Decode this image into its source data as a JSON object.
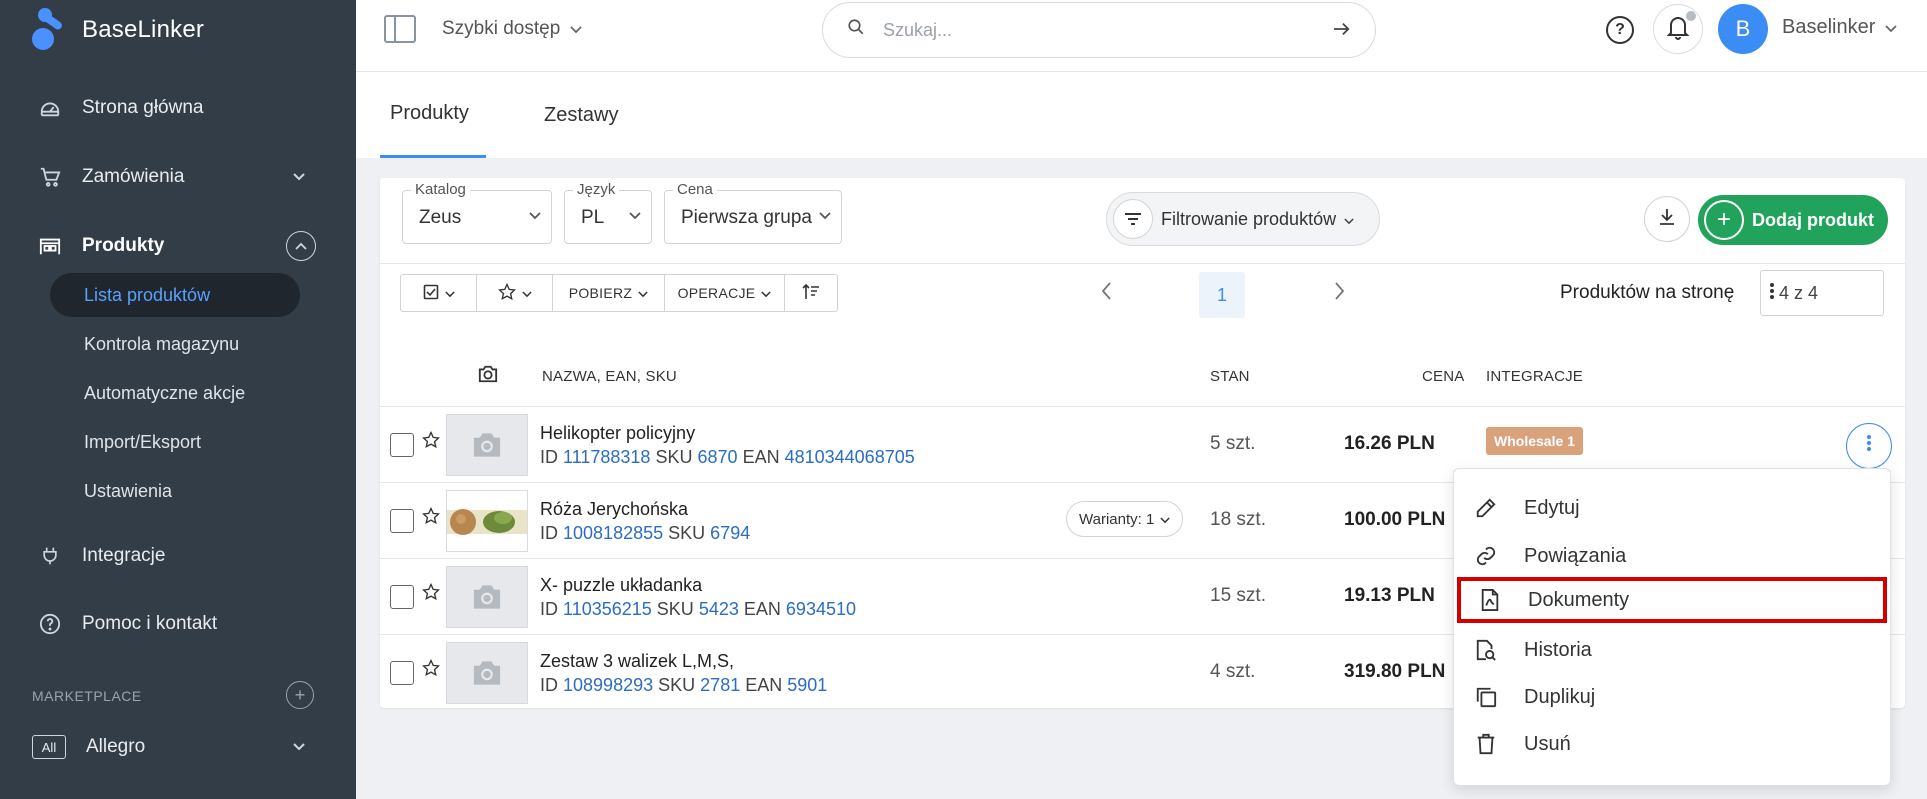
{
  "brand": {
    "name": "BaseLinker",
    "accent": "#3b8cf5",
    "sidebar_bg": "#333d47"
  },
  "sidebar": {
    "items": [
      {
        "label": "Strona główna",
        "icon": "dashboard-icon"
      },
      {
        "label": "Zamówienia",
        "icon": "cart-icon"
      },
      {
        "label": "Produkty",
        "icon": "warehouse-icon"
      },
      {
        "label": "Integracje",
        "icon": "plug-icon"
      },
      {
        "label": "Pomoc i kontakt",
        "icon": "help-circle-icon"
      }
    ],
    "sub_items": [
      {
        "label": "Lista produktów"
      },
      {
        "label": "Kontrola magazynu"
      },
      {
        "label": "Automatyczne akcje"
      },
      {
        "label": "Import/Eksport"
      },
      {
        "label": "Ustawienia"
      }
    ],
    "marketplace_label": "MARKETPLACE",
    "allegro": {
      "badge": "All",
      "label": "Allegro"
    }
  },
  "topbar": {
    "quick_access": "Szybki dostęp",
    "search_placeholder": "Szukaj...",
    "avatar_letter": "B",
    "user_name": "Baselinker"
  },
  "tabs": [
    {
      "label": "Produkty"
    },
    {
      "label": "Zestawy"
    }
  ],
  "filters": {
    "katalog": {
      "label": "Katalog",
      "value": "Zeus"
    },
    "jezyk": {
      "label": "Język",
      "value": "PL"
    },
    "cena": {
      "label": "Cena",
      "value": "Pierwsza grupa"
    },
    "filter_button": "Filtrowanie produktów",
    "add_button": "Dodaj produkt"
  },
  "toolbar": {
    "download_label": "POBIERZ",
    "operations_label": "OPERACJE",
    "page": "1",
    "per_page_label": "Produktów na stronę",
    "per_page_value": "4 z 4"
  },
  "columns": {
    "name": "NAZWA, EAN, SKU",
    "stock": "STAN",
    "price": "CENA",
    "integrations": "INTEGRACJE"
  },
  "products": [
    {
      "name": "Helikopter policyjny",
      "id_label": "ID",
      "id": "111788318",
      "sku_label": "SKU",
      "sku": "6870",
      "ean_label": "EAN",
      "ean": "4810344068705",
      "stock": "5 szt.",
      "price": "16.26 PLN",
      "badge": "Wholesale 1"
    },
    {
      "name": "Róża Jerychońska",
      "id_label": "ID",
      "id": "1008182855",
      "sku_label": "SKU",
      "sku": "6794",
      "variants": "Warianty: 1",
      "stock": "18 szt.",
      "price": "100.00 PLN"
    },
    {
      "name": "X- puzzle układanka",
      "id_label": "ID",
      "id": "110356215",
      "sku_label": "SKU",
      "sku": "5423",
      "ean_label": "EAN",
      "ean": "6934510",
      "stock": "15 szt.",
      "price": "19.13 PLN"
    },
    {
      "name": "Zestaw 3 walizek L,M,S,",
      "id_label": "ID",
      "id": "108998293",
      "sku_label": "SKU",
      "sku": "2781",
      "ean_label": "EAN",
      "ean": "5901",
      "stock": "4 szt.",
      "price": "319.80 PLN"
    }
  ],
  "menu": [
    {
      "label": "Edytuj",
      "icon": "pencil-icon"
    },
    {
      "label": "Powiązania",
      "icon": "link-icon"
    },
    {
      "label": "Dokumenty",
      "icon": "document-icon",
      "highlighted": true
    },
    {
      "label": "Historia",
      "icon": "history-search-icon"
    },
    {
      "label": "Duplikuj",
      "icon": "duplicate-icon"
    },
    {
      "label": "Usuń",
      "icon": "trash-icon"
    }
  ],
  "highlight_color": "#d40000",
  "add_button_color": "#21a35c",
  "badge_color": "#d9a27b"
}
